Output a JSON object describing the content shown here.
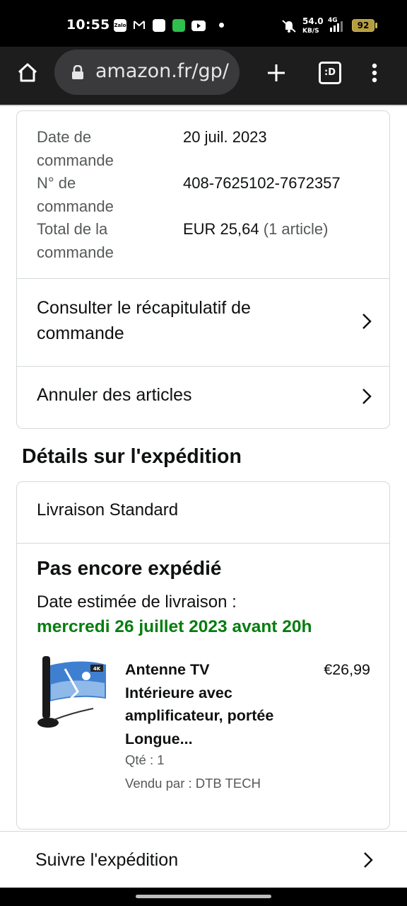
{
  "status_bar": {
    "time": "10:55",
    "app_icons": [
      "Zalo",
      "gmail-icon",
      "white-square-app",
      "green-app-icon",
      "youtube-icon"
    ],
    "network_speed_value": "54.0",
    "network_speed_unit": "KB/S",
    "network_type": "4G",
    "battery": "92"
  },
  "browser": {
    "url": "amazon.fr/gp/",
    "tab_badge": ":D"
  },
  "order_summary": {
    "date_label": "Date de commande",
    "date_value": "20 juil. 2023",
    "number_label": "N° de commande",
    "number_value": "408-7625102-7672357",
    "total_label": "Total de la commande",
    "total_value": "EUR 25,64",
    "total_items": "(1 article)"
  },
  "actions": {
    "view_summary": "Consulter le récapitulatif de commande",
    "cancel_items": "Annuler des articles"
  },
  "shipment": {
    "section_title": "Détails sur l'expédition",
    "method": "Livraison Standard",
    "status": "Pas encore expédié",
    "eta_label": "Date estimée de livraison :",
    "eta_date": "mercredi 26 juillet 2023 avant 20h",
    "accent_color": "#067d0f"
  },
  "product": {
    "title": "Antenne TV Intérieure avec amplificateur, portée Longue...",
    "price": "€26,99",
    "quantity": "Qté : 1",
    "seller": "Vendu par : DTB TECH",
    "image_badge": "4K"
  },
  "track": {
    "label": "Suivre l'expédition"
  }
}
